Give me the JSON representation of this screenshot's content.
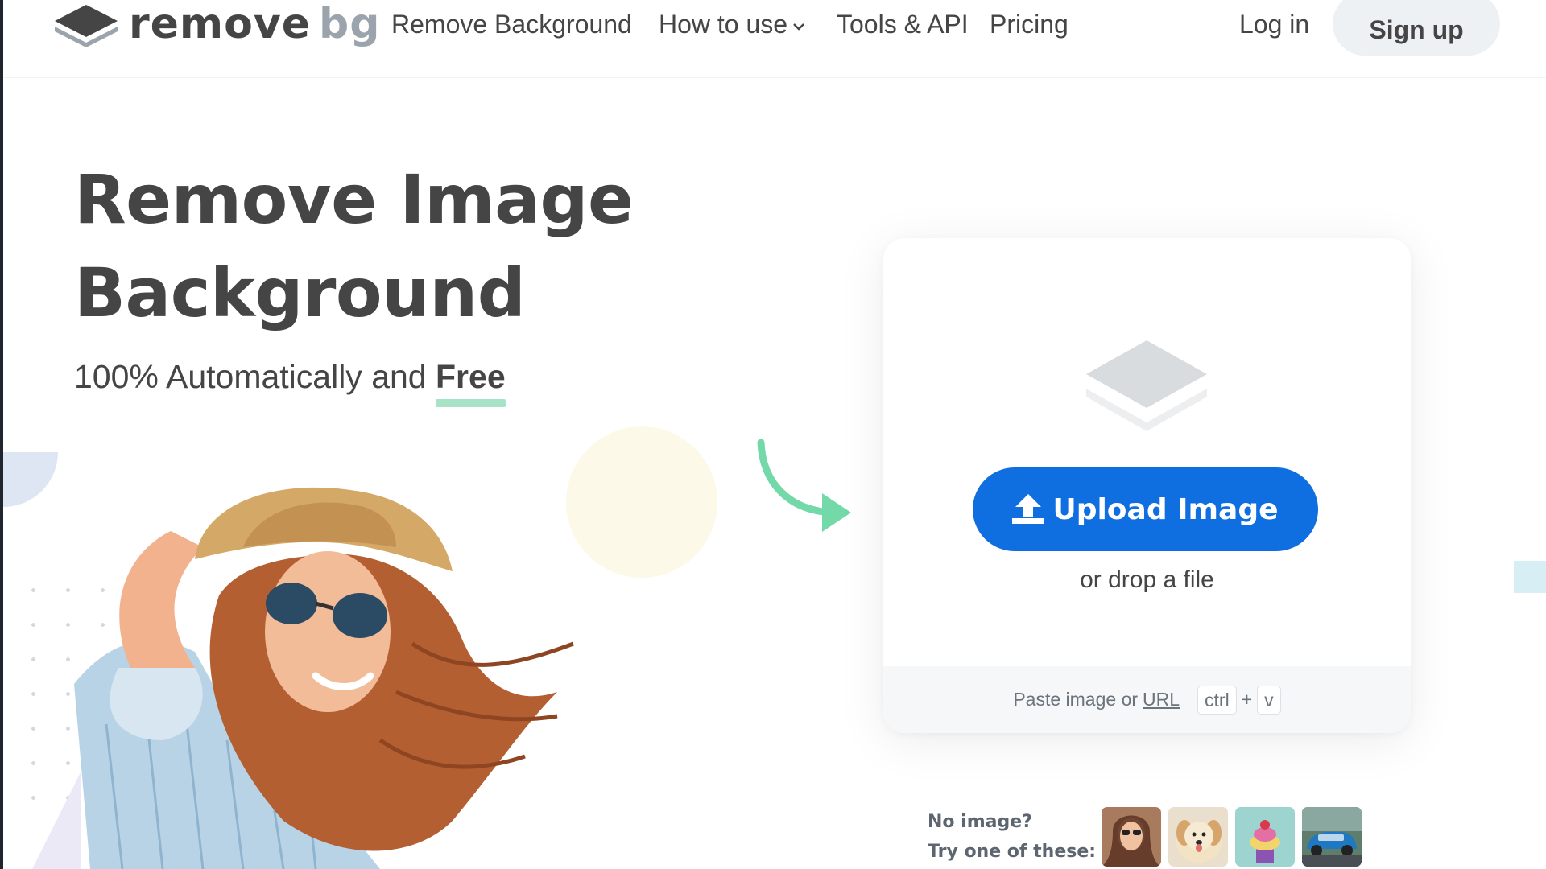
{
  "nav": {
    "logo_word1": "remove",
    "logo_word2": "bg",
    "links": [
      "Remove Background",
      "How to use",
      "Tools & API",
      "Pricing"
    ],
    "login": "Log in",
    "signup": "Sign up"
  },
  "hero": {
    "title_line1": "Remove Image",
    "title_line2": "Background",
    "subtitle_prefix": "100% Automatically and",
    "subtitle_emphasis": "Free"
  },
  "upload": {
    "button": "Upload Image",
    "drop": "or drop a file",
    "paste_prefix": "Paste image or",
    "paste_link": "URL",
    "key1": "ctrl",
    "plus": "+",
    "key2": "v"
  },
  "samples": {
    "line1": "No image?",
    "line2": "Try one of these:"
  },
  "colors": {
    "brand_blue": "#0f6ee0",
    "accent_green": "#a7e4c7",
    "text_dark": "#454545",
    "logo_gray": "#9ba4ad"
  },
  "icons": [
    "layers-logo-icon",
    "chevron-down-icon",
    "upload-icon",
    "curved-arrow-icon",
    "layers-placeholder-icon"
  ]
}
